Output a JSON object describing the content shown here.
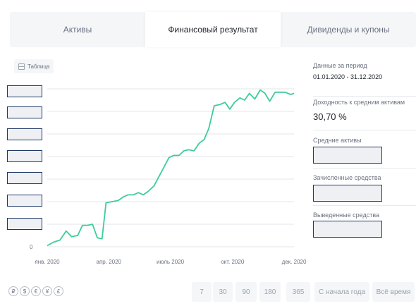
{
  "tabs": [
    {
      "label": "Активы",
      "active": false
    },
    {
      "label": "Финансовый результат",
      "active": true
    },
    {
      "label": "Дивиденды и купоны",
      "active": false
    }
  ],
  "table_button": {
    "label": "Таблица",
    "icon": "table-icon"
  },
  "side_panel": {
    "period_label": "Данные за период",
    "period_value": "01.01.2020 - 31.12.2020",
    "return_label": "Доходность к средним активам",
    "return_value": "30,70 %",
    "avg_assets_label": "Средние активы",
    "credited_label": "Зачисленные средства",
    "withdrawn_label": "Выведенные средства"
  },
  "currencies": [
    "₽",
    "$",
    "€",
    "¥",
    "£"
  ],
  "periods": [
    "7",
    "30",
    "90",
    "180",
    "365",
    "С начала года",
    "Всё время"
  ],
  "colors": {
    "line": "#3dcc9a",
    "grid": "#e3e6ea",
    "mask_border": "#1f3a66"
  },
  "chart_data": {
    "type": "line",
    "x_tick_labels": [
      "янв. 2020",
      "апр. 2020",
      "июль 2020",
      "окт. 2020",
      "дек. 2020"
    ],
    "x_tick_dates": [
      "2020-01-01",
      "2020-04-01",
      "2020-07-01",
      "2020-10-01",
      "2020-12-31"
    ],
    "y_tick_labels": [
      "0"
    ],
    "y_tick_count": 8,
    "grid": true,
    "y_range": [
      0,
      7
    ],
    "series": [
      {
        "x": [
          "2020-01-01",
          "2020-01-10",
          "2020-01-20",
          "2020-01-29",
          "2020-02-06",
          "2020-02-15",
          "2020-02-22",
          "2020-03-01",
          "2020-03-08",
          "2020-03-15",
          "2020-03-22",
          "2020-03-28",
          "2020-04-06",
          "2020-04-15",
          "2020-04-22",
          "2020-04-29",
          "2020-05-07",
          "2020-05-15",
          "2020-05-22",
          "2020-05-29",
          "2020-06-07",
          "2020-06-14",
          "2020-06-22",
          "2020-06-29",
          "2020-07-06",
          "2020-07-14",
          "2020-07-21",
          "2020-07-28",
          "2020-08-05",
          "2020-08-13",
          "2020-08-20",
          "2020-08-27",
          "2020-09-04",
          "2020-09-12",
          "2020-09-20",
          "2020-09-27",
          "2020-10-04",
          "2020-10-12",
          "2020-10-19",
          "2020-10-26",
          "2020-11-03",
          "2020-11-11",
          "2020-11-18",
          "2020-11-25",
          "2020-12-03",
          "2020-12-11",
          "2020-12-18",
          "2020-12-26",
          "2020-12-31"
        ],
        "y": [
          0.05,
          0.2,
          0.3,
          0.7,
          0.45,
          0.5,
          0.95,
          0.95,
          1.0,
          0.4,
          0.35,
          1.95,
          2.0,
          2.05,
          2.2,
          2.3,
          2.3,
          2.4,
          2.3,
          2.45,
          2.7,
          3.1,
          3.55,
          3.95,
          4.05,
          4.05,
          4.25,
          4.3,
          4.25,
          4.6,
          4.75,
          5.25,
          6.25,
          6.3,
          6.4,
          6.1,
          6.4,
          6.6,
          6.5,
          6.8,
          6.55,
          6.95,
          6.8,
          6.45,
          6.85,
          6.85,
          6.85,
          6.75,
          6.8
        ]
      }
    ]
  }
}
